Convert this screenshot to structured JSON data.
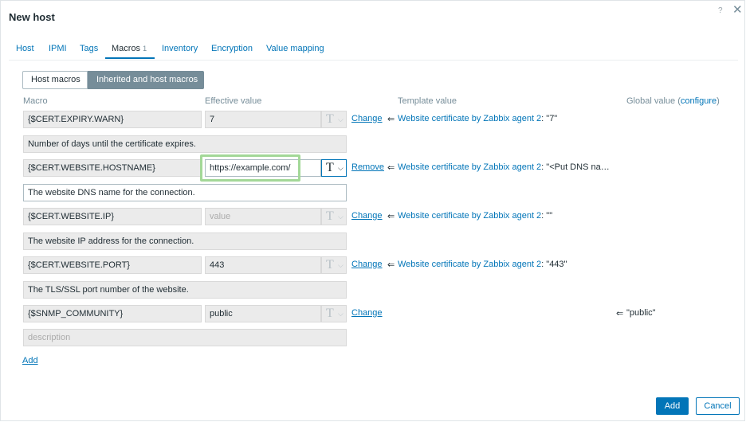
{
  "dialog": {
    "title": "New host",
    "help_glyph": "?",
    "close_glyph": "✕",
    "icons": {
      "help": "help-icon",
      "close": "close-icon"
    }
  },
  "tabs": [
    {
      "label": "Host"
    },
    {
      "label": "IPMI"
    },
    {
      "label": "Tags"
    },
    {
      "label": "Macros",
      "count": "1",
      "active": true
    },
    {
      "label": "Inventory"
    },
    {
      "label": "Encryption"
    },
    {
      "label": "Value mapping"
    }
  ],
  "segmented": {
    "host_macros": "Host macros",
    "inherited_macros": "Inherited and host macros",
    "selected": "Inherited and host macros"
  },
  "columns": {
    "macro": "Macro",
    "effective": "Effective value",
    "template": "Template value",
    "global_prefix": "Global value (",
    "global_link": "configure",
    "global_suffix": ")"
  },
  "type_button": {
    "glyph": "T",
    "caret": "⌵",
    "icon": "text-type-icon"
  },
  "macros": [
    {
      "name": "{$CERT.EXPIRY.WARN}",
      "value": "7",
      "action": "Change",
      "eq": "⇐",
      "template_link": "Website certificate by Zabbix agent 2",
      "template_value": ": \"7\"",
      "global_value": "",
      "description": "Number of days until the certificate expires."
    },
    {
      "name": "{$CERT.WEBSITE.HOSTNAME}",
      "value": "https://example.com/",
      "action": "Remove",
      "eq": "⇐",
      "template_link": "Website certificate by Zabbix agent 2",
      "template_value": ": \"<Put DNS na…",
      "global_value": "",
      "description": "The website DNS name for the connection."
    },
    {
      "name": "{$CERT.WEBSITE.IP}",
      "value": "",
      "value_placeholder": "value",
      "action": "Change",
      "eq": "⇐",
      "template_link": "Website certificate by Zabbix agent 2",
      "template_value": ": \"\"",
      "global_value": "",
      "description": "The website IP address for the connection."
    },
    {
      "name": "{$CERT.WEBSITE.PORT}",
      "value": "443",
      "action": "Change",
      "eq": "⇐",
      "template_link": "Website certificate by Zabbix agent 2",
      "template_value": ": \"443\"",
      "global_value": "",
      "description": "The TLS/SSL port number of the website."
    },
    {
      "name": "{$SNMP_COMMUNITY}",
      "value": "public",
      "action": "Change",
      "eq": "⇐",
      "template_link": "",
      "template_value": "",
      "global_value": "\"public\"",
      "description": "",
      "description_placeholder": "description"
    }
  ],
  "add_link": "Add",
  "footer": {
    "add": "Add",
    "cancel": "Cancel"
  }
}
